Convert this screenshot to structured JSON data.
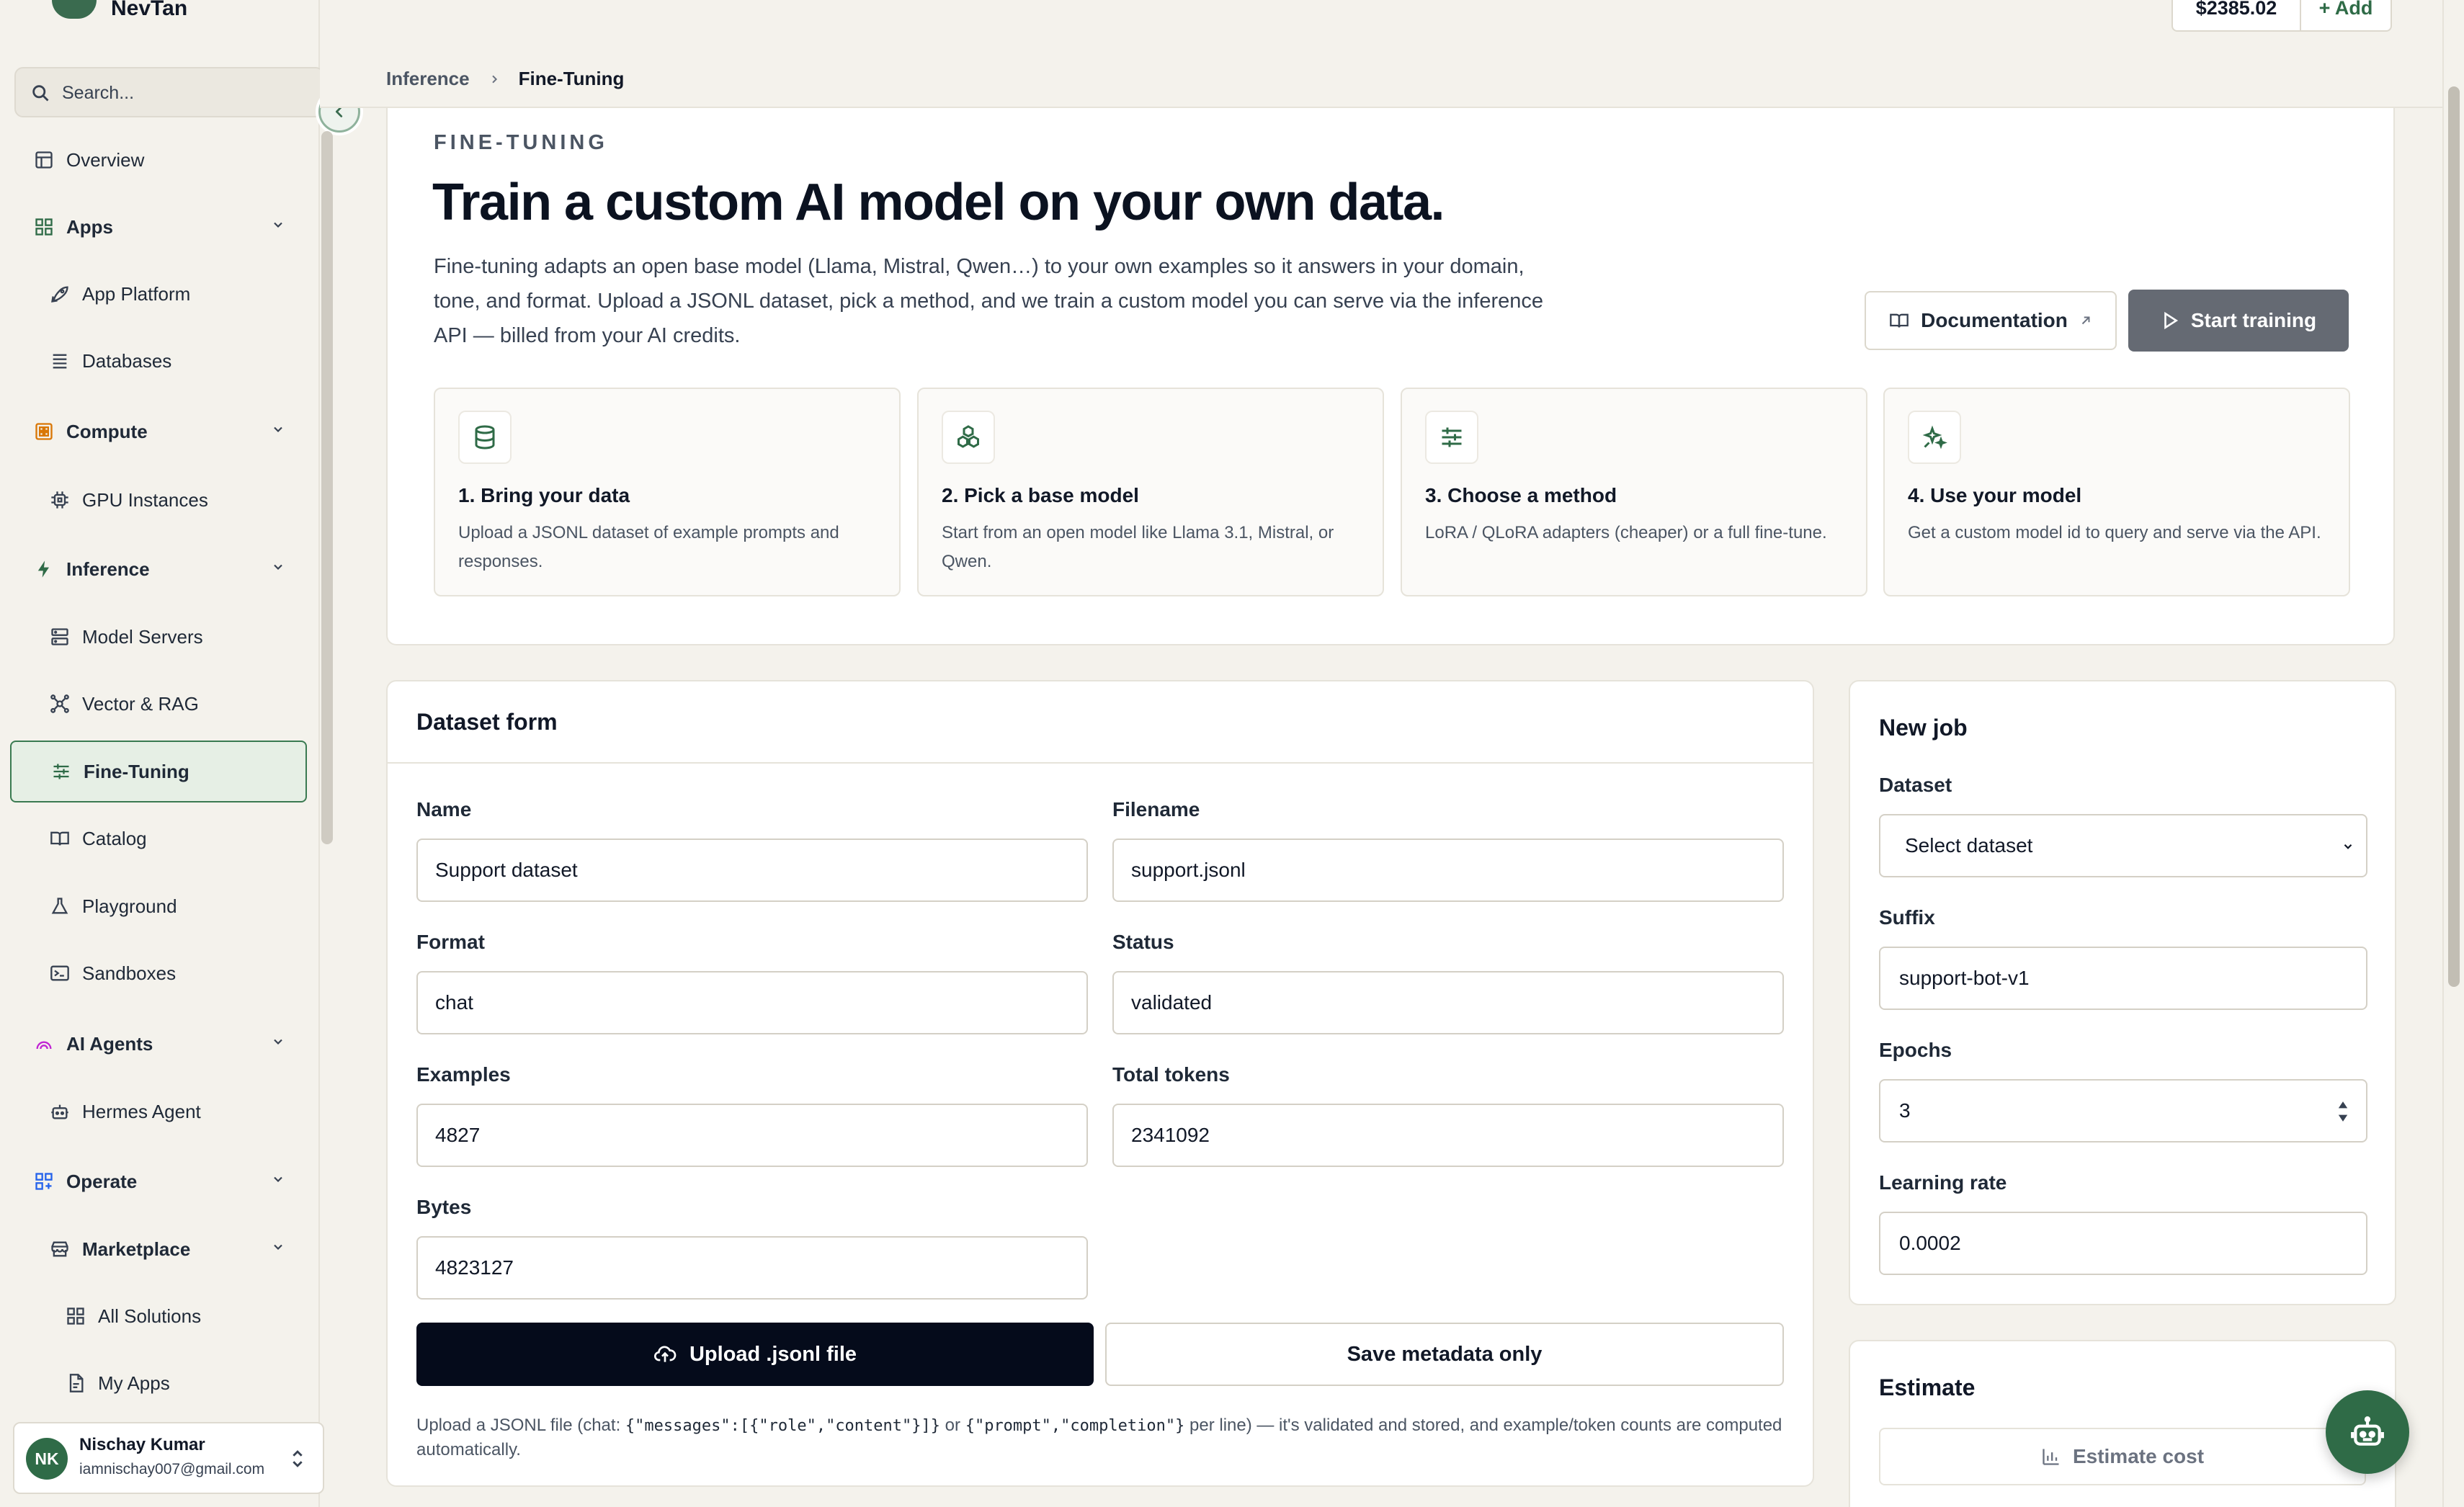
{
  "app": {
    "brand": "NevTan",
    "balance": "$2385.02",
    "add_label": "+ Add"
  },
  "colors": {
    "brand": "#2f6b47",
    "primary_button": "#050b1b",
    "start_training_bg": "#656a73",
    "page_bg": "#f4f2ec"
  },
  "sidebar": {
    "search_placeholder": "Search...",
    "items": [
      {
        "label": "Overview",
        "icon": "layout-icon"
      },
      {
        "label": "Apps",
        "icon": "apps-icon",
        "section": true
      },
      {
        "label": "App Platform",
        "icon": "rocket-icon"
      },
      {
        "label": "Databases",
        "icon": "database-icon"
      },
      {
        "label": "Compute",
        "icon": "compute-icon",
        "section": true
      },
      {
        "label": "GPU Instances",
        "icon": "cpu-icon"
      },
      {
        "label": "Inference",
        "icon": "bolt-icon",
        "section": true
      },
      {
        "label": "Model Servers",
        "icon": "server-icon"
      },
      {
        "label": "Vector & RAG",
        "icon": "network-icon"
      },
      {
        "label": "Fine-Tuning",
        "icon": "sliders-icon",
        "active": true
      },
      {
        "label": "Catalog",
        "icon": "book-icon"
      },
      {
        "label": "Playground",
        "icon": "flask-icon"
      },
      {
        "label": "Sandboxes",
        "icon": "terminal-icon"
      },
      {
        "label": "AI Agents",
        "icon": "agents-icon",
        "section": true
      },
      {
        "label": "Hermes Agent",
        "icon": "bot-icon"
      },
      {
        "label": "Operate",
        "icon": "operate-icon",
        "section": true
      },
      {
        "label": "Marketplace",
        "icon": "store-icon",
        "section": true
      },
      {
        "label": "All Solutions",
        "icon": "grid-icon"
      },
      {
        "label": "My Apps",
        "icon": "file-icon"
      }
    ],
    "user": {
      "initials": "NK",
      "name": "Nischay Kumar",
      "email": "iamnischay007@gmail.com"
    }
  },
  "breadcrumb": {
    "parent": "Inference",
    "current": "Fine-Tuning"
  },
  "hero": {
    "eyebrow": "FINE-TUNING",
    "title": "Train a custom AI model on your own data.",
    "description": "Fine-tuning adapts an open base model (Llama, Mistral, Qwen…) to your own examples so it answers in your domain, tone, and format. Upload a JSONL dataset, pick a method, and we train a custom model you can serve via the inference API — billed from your AI credits.",
    "docs_label": "Documentation",
    "start_label": "Start training",
    "steps": [
      {
        "title": "1. Bring your data",
        "desc": "Upload a JSONL dataset of example prompts and responses.",
        "icon": "database-icon"
      },
      {
        "title": "2. Pick a base model",
        "desc": "Start from an open model like Llama 3.1, Mistral, or Qwen.",
        "icon": "cubes-icon"
      },
      {
        "title": "3. Choose a method",
        "desc": "LoRA / QLoRA adapters (cheaper) or a full fine-tune.",
        "icon": "sliders-icon"
      },
      {
        "title": "4. Use your model",
        "desc": "Get a custom model id to query and serve via the API.",
        "icon": "sparkles-icon"
      }
    ]
  },
  "dataset_form": {
    "title": "Dataset form",
    "fields": {
      "name": {
        "label": "Name",
        "value": "Support dataset"
      },
      "filename": {
        "label": "Filename",
        "value": "support.jsonl"
      },
      "format": {
        "label": "Format",
        "value": "chat"
      },
      "status": {
        "label": "Status",
        "value": "validated"
      },
      "examples": {
        "label": "Examples",
        "value": "4827"
      },
      "total_tokens": {
        "label": "Total tokens",
        "value": "2341092"
      },
      "bytes": {
        "label": "Bytes",
        "value": "4823127"
      }
    },
    "upload_label": "Upload .jsonl file",
    "save_label": "Save metadata only",
    "note_prefix": "Upload a JSONL file (chat: ",
    "note_code1": "{\"messages\":[{\"role\",\"content\"}]}",
    "note_or": " or ",
    "note_code2": "{\"prompt\",\"completion\"}",
    "note_suffix": " per line) — it's validated and stored, and example/token counts are computed automatically."
  },
  "new_job": {
    "title": "New job",
    "dataset_label": "Dataset",
    "dataset_value": "Select dataset",
    "suffix_label": "Suffix",
    "suffix_value": "support-bot-v1",
    "epochs_label": "Epochs",
    "epochs_value": "3",
    "lr_label": "Learning rate",
    "lr_value": "0.0002"
  },
  "estimate": {
    "title": "Estimate",
    "button_label": "Estimate cost"
  }
}
